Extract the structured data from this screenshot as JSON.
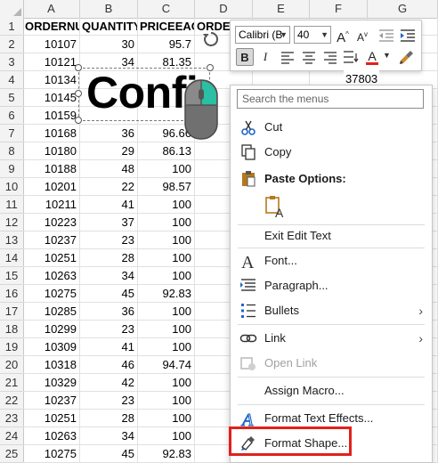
{
  "columns": [
    "A",
    "B",
    "C",
    "D",
    "E",
    "F",
    "G"
  ],
  "rows": [
    "1",
    "2",
    "3",
    "4",
    "5",
    "6",
    "7",
    "8",
    "9",
    "10",
    "11",
    "12",
    "13",
    "14",
    "15",
    "16",
    "17",
    "18",
    "19",
    "20",
    "21",
    "22",
    "23",
    "24",
    "25"
  ],
  "cells": [
    [
      "ORDERNUMBER",
      "QUANTITY",
      "PRICEEACH",
      "ORDER",
      "",
      "",
      ""
    ],
    [
      "10107",
      "30",
      "95.7",
      "",
      "",
      "",
      ""
    ],
    [
      "10121",
      "34",
      "81.35",
      "",
      "",
      "",
      ""
    ],
    [
      "10134",
      "",
      "",
      "",
      "",
      "",
      ""
    ],
    [
      "10145",
      "",
      "",
      "",
      "",
      "",
      ""
    ],
    [
      "10159",
      "",
      "",
      "",
      "",
      "",
      ""
    ],
    [
      "10168",
      "36",
      "96.66",
      "",
      "",
      "",
      ""
    ],
    [
      "10180",
      "29",
      "86.13",
      "",
      "",
      "",
      ""
    ],
    [
      "10188",
      "48",
      "100",
      "",
      "",
      "",
      ""
    ],
    [
      "10201",
      "22",
      "98.57",
      "",
      "",
      "",
      ""
    ],
    [
      "10211",
      "41",
      "100",
      "",
      "",
      "",
      ""
    ],
    [
      "10223",
      "37",
      "100",
      "",
      "",
      "",
      ""
    ],
    [
      "10237",
      "23",
      "100",
      "",
      "",
      "",
      ""
    ],
    [
      "10251",
      "28",
      "100",
      "",
      "",
      "",
      ""
    ],
    [
      "10263",
      "34",
      "100",
      "",
      "",
      "",
      ""
    ],
    [
      "10275",
      "45",
      "92.83",
      "",
      "",
      "",
      ""
    ],
    [
      "10285",
      "36",
      "100",
      "",
      "",
      "",
      ""
    ],
    [
      "10299",
      "23",
      "100",
      "",
      "",
      "",
      ""
    ],
    [
      "10309",
      "41",
      "100",
      "",
      "",
      "",
      ""
    ],
    [
      "10318",
      "46",
      "94.74",
      "",
      "",
      "",
      ""
    ],
    [
      "10329",
      "42",
      "100",
      "",
      "",
      "",
      ""
    ],
    [
      "10237",
      "23",
      "100",
      "",
      "",
      "",
      ""
    ],
    [
      "10251",
      "28",
      "100",
      "",
      "",
      "",
      ""
    ],
    [
      "10263",
      "34",
      "100",
      "",
      "",
      "",
      ""
    ],
    [
      "10275",
      "45",
      "92.83",
      "",
      "",
      "",
      ""
    ]
  ],
  "cell_F4": "37803",
  "shape": {
    "text": "Confidential"
  },
  "mini_toolbar": {
    "font_name": "Calibri (B",
    "font_size": "40",
    "grow_font": "A",
    "shrink_font": "A",
    "bold": "B",
    "italic": "I",
    "font_color_letter": "A",
    "font_color": "#e0211b"
  },
  "context_menu": {
    "search_placeholder": "Search the menus",
    "cut": "Cut",
    "copy": "Copy",
    "paste_options": "Paste Options:",
    "exit_edit_text": "Exit Edit Text",
    "font": "Font...",
    "paragraph": "Paragraph...",
    "bullets": "Bullets",
    "link": "Link",
    "open_link": "Open Link",
    "assign_macro": "Assign Macro...",
    "format_text_effects": "Format Text Effects...",
    "format_shape": "Format Shape..."
  },
  "colors": {
    "accent_teal": "#2bbfa4",
    "highlight_red": "#e0211b",
    "icon_blue": "#1e66c8",
    "paste_gold": "#b5781e"
  }
}
